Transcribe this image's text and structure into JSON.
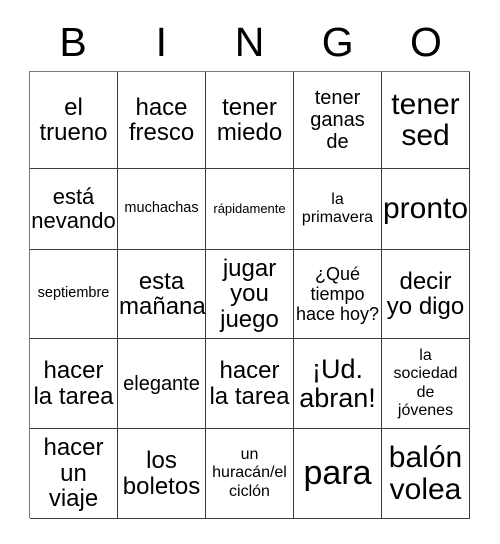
{
  "card": {
    "header": {
      "letters": [
        "B",
        "I",
        "N",
        "G",
        "O"
      ]
    },
    "rows": [
      [
        {
          "text": "el\ntrueno",
          "size": "fs-l"
        },
        {
          "text": "hace\nfresco",
          "size": "fs-l"
        },
        {
          "text": "tener\nmiedo",
          "size": "fs-l"
        },
        {
          "text": "tener\nganas\nde",
          "size": "fs-m"
        },
        {
          "text": "tener\nsed",
          "size": "fs-xxl"
        }
      ],
      [
        {
          "text": "está\nnevando",
          "size": "fs-ml"
        },
        {
          "text": "muchachas",
          "size": "fs-xs"
        },
        {
          "text": "rápidamente",
          "size": "fs-xxs"
        },
        {
          "text": "la\nprimavera",
          "size": "fs-s"
        },
        {
          "text": "pronto",
          "size": "fs-xxl"
        }
      ],
      [
        {
          "text": "septiembre",
          "size": "fs-xs"
        },
        {
          "text": "esta\nmañana",
          "size": "fs-l"
        },
        {
          "text": "jugar\nyou\njuego",
          "size": "fs-l"
        },
        {
          "text": "¿Qué\ntiempo\nhace hoy?",
          "size": "fs-sm"
        },
        {
          "text": "decir\nyo digo",
          "size": "fs-l"
        }
      ],
      [
        {
          "text": "hacer\nla tarea",
          "size": "fs-l"
        },
        {
          "text": "elegante",
          "size": "fs-m"
        },
        {
          "text": "hacer\nla tarea",
          "size": "fs-l"
        },
        {
          "text": "¡Ud.\nabran!",
          "size": "fs-xl"
        },
        {
          "text": "la\nsociedad\nde\njóvenes",
          "size": "fs-s"
        }
      ],
      [
        {
          "text": "hacer\nun\nviaje",
          "size": "fs-l"
        },
        {
          "text": "los\nboletos",
          "size": "fs-l"
        },
        {
          "text": "un\nhuracán/el\nciclón",
          "size": "fs-s"
        },
        {
          "text": "para",
          "size": "fs-3xl"
        },
        {
          "text": "balón\nvolea",
          "size": "fs-xxl"
        }
      ]
    ]
  }
}
